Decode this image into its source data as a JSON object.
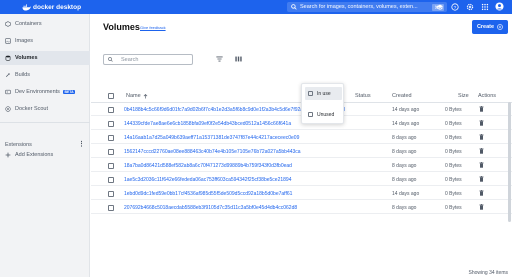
{
  "app": {
    "logo_text": "docker desktop",
    "search_placeholder": "Search for images, containers, volumes, exten...",
    "search_shortcut": "⌘K",
    "brand_color": "#1d63ed"
  },
  "sidebar": {
    "items": [
      {
        "label": "Containers",
        "icon": "containers-icon",
        "active": false
      },
      {
        "label": "Images",
        "icon": "images-icon",
        "active": false
      },
      {
        "label": "Volumes",
        "icon": "volumes-icon",
        "active": true
      },
      {
        "label": "Builds",
        "icon": "builds-icon",
        "active": false
      },
      {
        "label": "Dev Environments",
        "icon": "dev-environments-icon",
        "active": false,
        "badge": "BETA"
      },
      {
        "label": "Docker Scout",
        "icon": "docker-scout-icon",
        "active": false
      }
    ],
    "extensions_label": "Extensions",
    "add_extensions_label": "Add Extensions"
  },
  "main": {
    "title": "Volumes",
    "feedback_link": "Give feedback",
    "create_label": "Create",
    "search_placeholder": "Search"
  },
  "filter_popup": {
    "options": [
      {
        "label": "In use",
        "checked": false
      },
      {
        "label": "Unused",
        "checked": false
      }
    ]
  },
  "table": {
    "columns": [
      "Name",
      "Status",
      "Created",
      "Size",
      "Actions"
    ],
    "rows": [
      {
        "name": "0b4188b4c5c66f9d6d01fc7a9d02b6f7c4b1e2d3a5f6b8c9d0e1f2a3b4c5d6e7f92a10f52ea168bf52ed",
        "status": "",
        "created": "14 days ago",
        "size": "0 Bytes"
      },
      {
        "name": "144339cfde7ae8ae6e6cb1858bfa09ef0f2e54db43bced0512a1456c66f641a",
        "status": "",
        "created": "14 days ago",
        "size": "0 Bytes"
      },
      {
        "name": "14a16aab1a7d25a049b639aeff71a15371381de3747f87e44c4217aceceec0e09",
        "status": "",
        "created": "8 days ago",
        "size": "0 Bytes"
      },
      {
        "name": "1562147cccd22760ae08ee888463c40b74e4b105e7105e76b72a027a5bb443ca",
        "status": "",
        "created": "8 days ago",
        "size": "0 Bytes"
      },
      {
        "name": "18a7ba0d86421d588ef582ab8a6c70f471273d99889b4b759f343f0d3fb0ead",
        "status": "",
        "created": "8 days ago",
        "size": "0 Bytes"
      },
      {
        "name": "1ae5c3d2036c11f642e66fededa06ac753ff603ca594342f25cf38be5ce21894",
        "status": "",
        "created": "8 days ago",
        "size": "0 Bytes"
      },
      {
        "name": "1ebd0d9dc1fed59e0bb17cf4536af985d55f5de509d5ccd92a18b5d0be7aff61",
        "status": "",
        "created": "14 days ago",
        "size": "0 Bytes"
      },
      {
        "name": "207692b4668c5018aecdab5588eb3f9105d7c35d11c3a5bf0e45d4db4cc062d8",
        "status": "",
        "created": "8 days ago",
        "size": "0 Bytes"
      }
    ],
    "footer_text": "Showing 34 items"
  }
}
